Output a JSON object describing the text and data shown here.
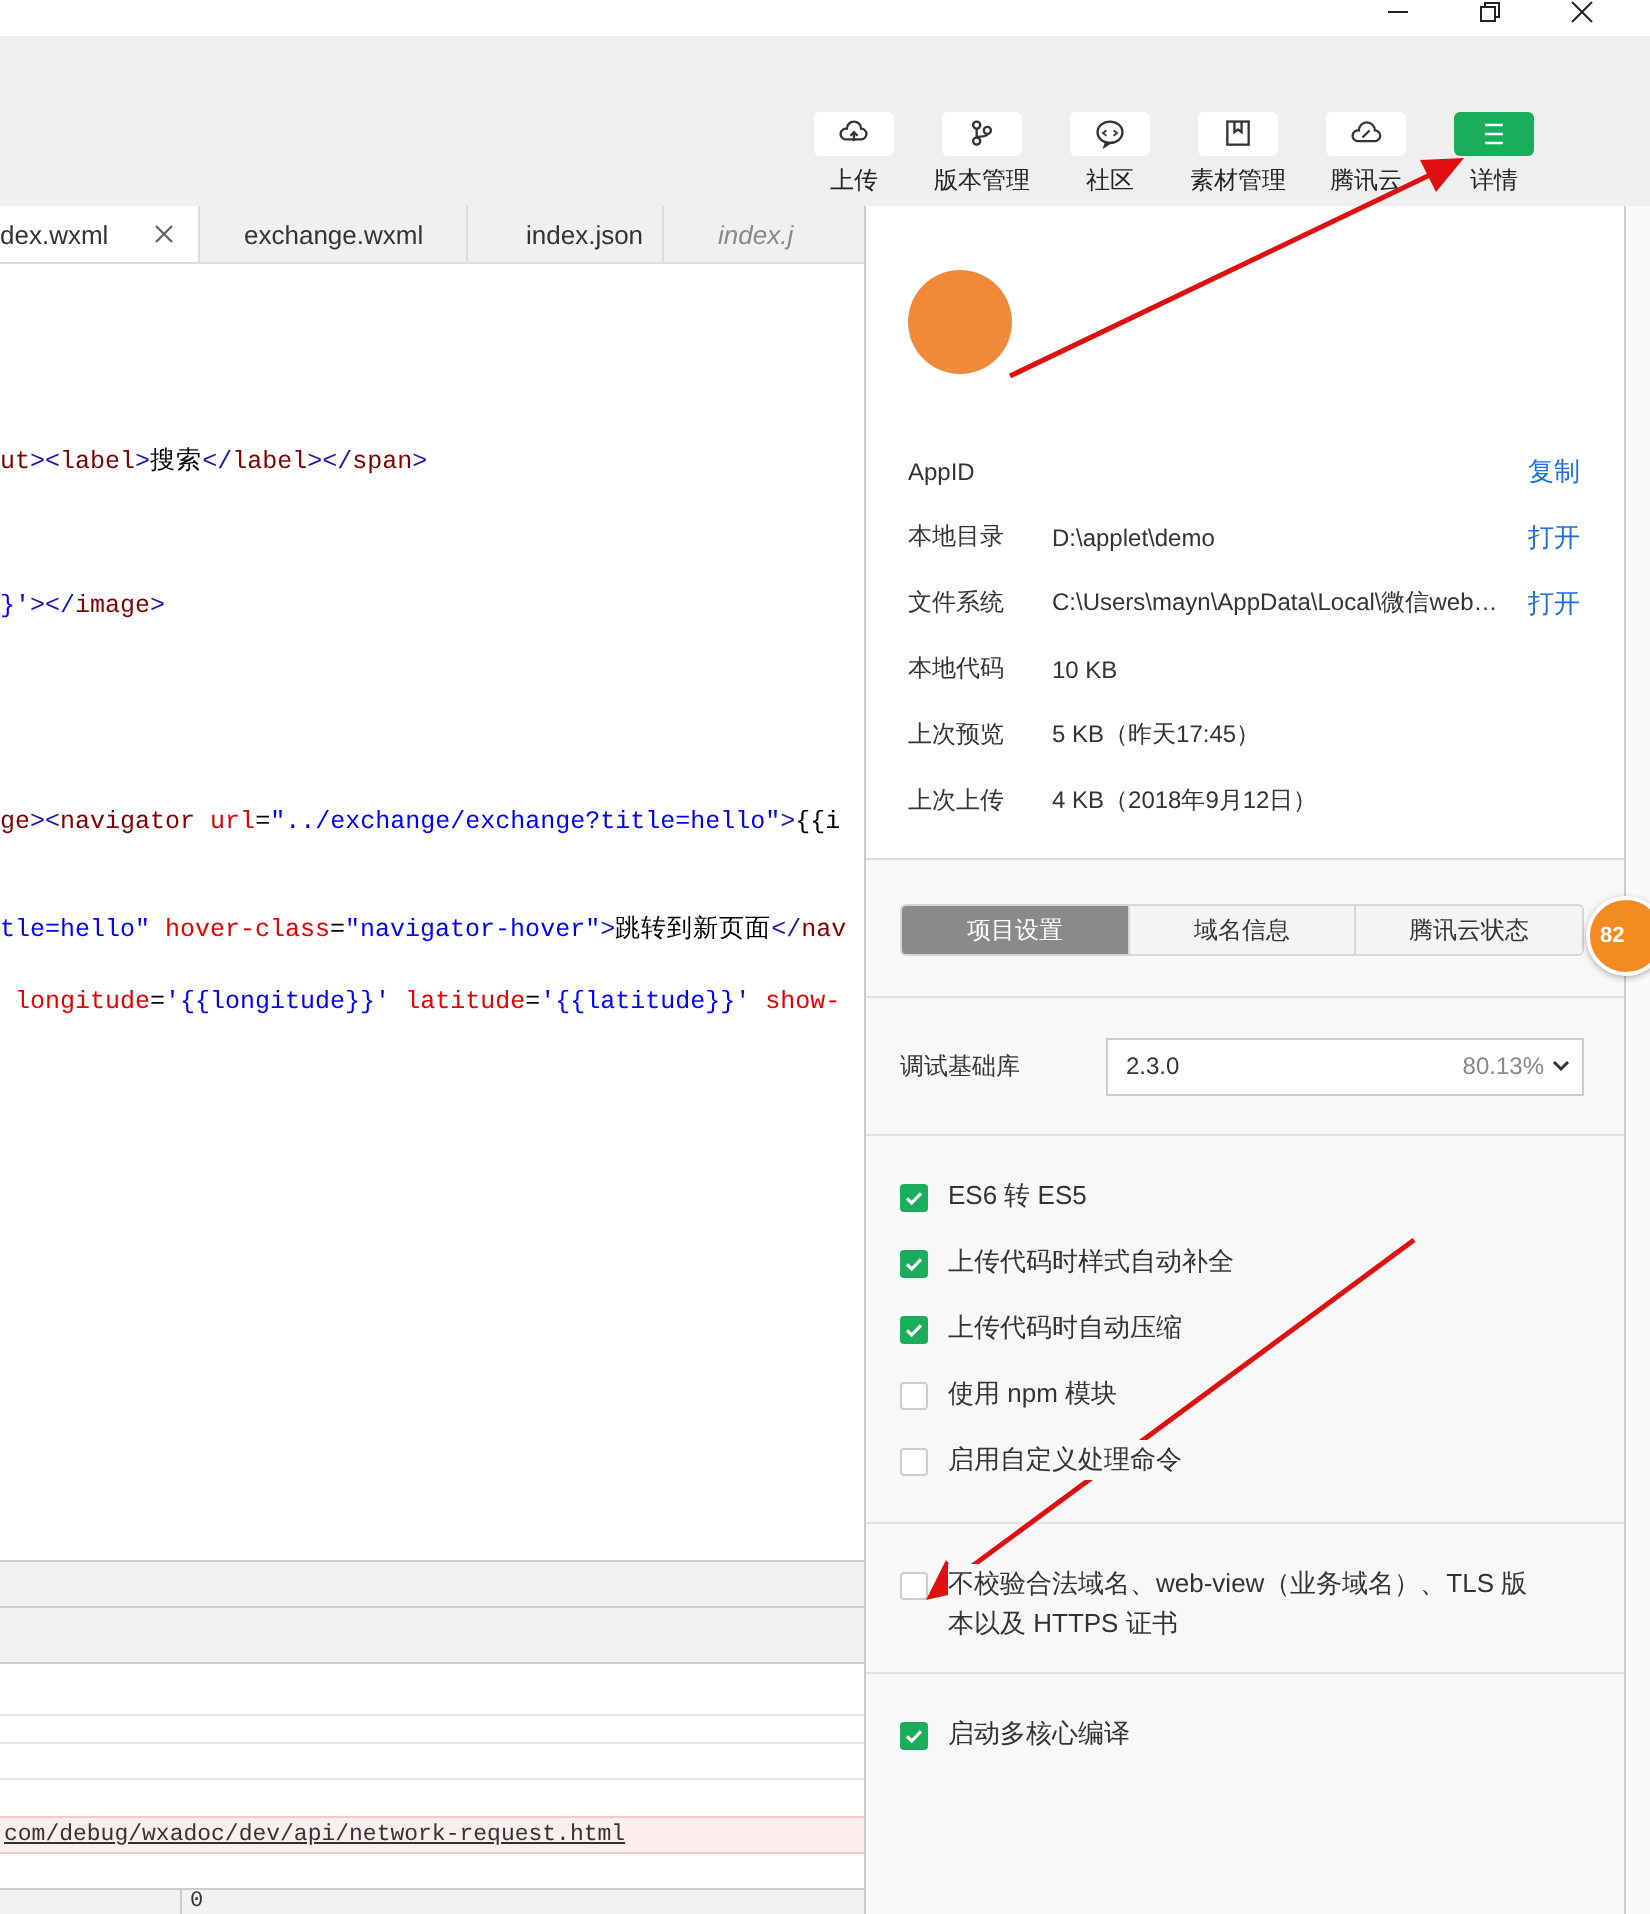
{
  "toolbar": {
    "buttons": [
      {
        "label": "上传",
        "selected": false
      },
      {
        "label": "版本管理",
        "selected": false
      },
      {
        "label": "社区",
        "selected": false
      },
      {
        "label": "素材管理",
        "selected": false
      },
      {
        "label": "腾讯云",
        "selected": false
      },
      {
        "label": "详情",
        "selected": true
      }
    ]
  },
  "editor_tabs": [
    {
      "label": "dex.wxml",
      "selected": true,
      "preview": false
    },
    {
      "label": "exchange.wxml",
      "selected": false,
      "preview": false
    },
    {
      "label": "index.json",
      "selected": false,
      "preview": false
    },
    {
      "label": "index.j",
      "selected": false,
      "preview": true
    }
  ],
  "code_lines": [
    {
      "kind": "blank"
    },
    {
      "kind": "blank"
    },
    {
      "kind": "blank"
    },
    {
      "kind": "blank"
    },
    {
      "kind": "blank"
    },
    {
      "kind": "code",
      "tokens": [
        {
          "kind": "tag",
          "text": "ut"
        },
        {
          "kind": "punct",
          "text": "><"
        },
        {
          "kind": "tag",
          "text": "label"
        },
        {
          "kind": "punct",
          "text": ">"
        },
        {
          "kind": "text",
          "text": "搜索"
        },
        {
          "kind": "punct",
          "text": "</"
        },
        {
          "kind": "tag",
          "text": "label"
        },
        {
          "kind": "punct",
          "text": "></"
        },
        {
          "kind": "tag",
          "text": "span"
        },
        {
          "kind": "punct",
          "text": ">"
        }
      ]
    },
    {
      "kind": "blank"
    },
    {
      "kind": "blank"
    },
    {
      "kind": "blank"
    },
    {
      "kind": "code",
      "tokens": [
        {
          "kind": "value",
          "text": "}'"
        },
        {
          "kind": "punct",
          "text": "></"
        },
        {
          "kind": "tag",
          "text": "image"
        },
        {
          "kind": "punct",
          "text": ">"
        }
      ]
    },
    {
      "kind": "blank"
    },
    {
      "kind": "blank"
    },
    {
      "kind": "blank"
    },
    {
      "kind": "blank"
    },
    {
      "kind": "blank"
    },
    {
      "kind": "code",
      "tokens": [
        {
          "kind": "tag",
          "text": "ge"
        },
        {
          "kind": "punct",
          "text": "><"
        },
        {
          "kind": "tag",
          "text": "navigator "
        },
        {
          "kind": "attr",
          "text": "url"
        },
        {
          "kind": "text",
          "text": "="
        },
        {
          "kind": "value",
          "text": "\"../exchange/exchange?title=hello\""
        },
        {
          "kind": "punct",
          "text": ">"
        },
        {
          "kind": "text",
          "text": "{{i"
        }
      ]
    },
    {
      "kind": "blank"
    },
    {
      "kind": "blank"
    },
    {
      "kind": "code",
      "tokens": [
        {
          "kind": "value",
          "text": "tle=hello\" "
        },
        {
          "kind": "attr",
          "text": "hover-class"
        },
        {
          "kind": "text",
          "text": "="
        },
        {
          "kind": "value",
          "text": "\"navigator-hover\""
        },
        {
          "kind": "punct",
          "text": ">"
        },
        {
          "kind": "text",
          "text": "跳转到新页面"
        },
        {
          "kind": "punct",
          "text": "</"
        },
        {
          "kind": "tag",
          "text": "nav"
        }
      ]
    },
    {
      "kind": "blank"
    },
    {
      "kind": "code",
      "tokens": [
        {
          "kind": "attr",
          "text": " longitude"
        },
        {
          "kind": "text",
          "text": "="
        },
        {
          "kind": "value",
          "text": "'{{longitude}}' "
        },
        {
          "kind": "attr",
          "text": "latitude"
        },
        {
          "kind": "text",
          "text": "="
        },
        {
          "kind": "value",
          "text": "'{{latitude}}' "
        },
        {
          "kind": "attr",
          "text": "show-"
        }
      ]
    }
  ],
  "console": {
    "link": "com/debug/wxadoc/dev/api/network-request.html",
    "footer_value": "0"
  },
  "details": {
    "info_rows": [
      {
        "label": "AppID",
        "action": "复制"
      },
      {
        "label": "本地目录",
        "value": "D:\\applet\\demo",
        "action": "打开"
      },
      {
        "label": "文件系统",
        "value": "C:\\Users\\mayn\\AppData\\Local\\微信web…",
        "action": "打开"
      },
      {
        "label": "本地代码",
        "value": "10 KB"
      },
      {
        "label": "上次预览",
        "value": "5 KB（昨天17:45）"
      },
      {
        "label": "上次上传",
        "value": "4 KB（2018年9月12日）"
      }
    ],
    "tabs": [
      {
        "label": "项目设置",
        "selected": true
      },
      {
        "label": "域名信息",
        "selected": false
      },
      {
        "label": "腾讯云状态",
        "selected": false
      }
    ],
    "badge": "82",
    "library": {
      "label": "调试基础库",
      "value": "2.3.0",
      "share": "80.13%"
    },
    "option_groups": [
      {
        "options": [
          {
            "label": "ES6 转 ES5",
            "checked": true
          },
          {
            "label": "上传代码时样式自动补全",
            "checked": true
          },
          {
            "label": "上传代码时自动压缩",
            "checked": true
          },
          {
            "label": "使用 npm 模块",
            "checked": false
          },
          {
            "label": "启用自定义处理命令",
            "checked": false
          }
        ]
      },
      {
        "options": [
          {
            "label": "不校验合法域名、web-view（业务域名）、TLS 版本以及 HTTPS 证书",
            "checked": false
          }
        ]
      },
      {
        "options": [
          {
            "label": "启动多核心编译",
            "checked": true
          }
        ]
      }
    ]
  }
}
